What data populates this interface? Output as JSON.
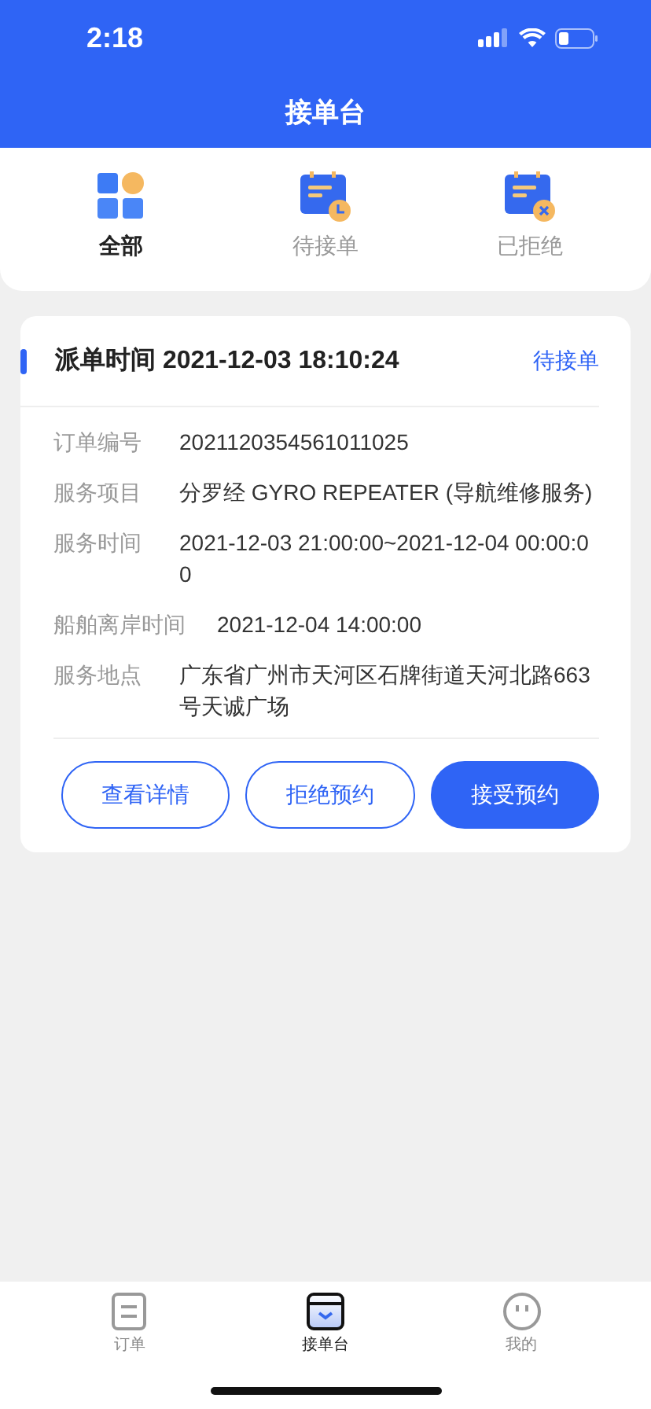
{
  "status_bar": {
    "time": "2:18"
  },
  "header": {
    "title": "接单台"
  },
  "tabs": [
    {
      "label": "全部",
      "kind": "all",
      "selected": true
    },
    {
      "label": "待接单",
      "kind": "pending",
      "selected": false
    },
    {
      "label": "已拒绝",
      "kind": "rejected",
      "selected": false
    }
  ],
  "order": {
    "dispatch_time": "派单时间 2021-12-03 18:10:24",
    "status": "待接单",
    "fields": [
      {
        "label": "订单编号",
        "value": "2021120354561011025"
      },
      {
        "label": "服务项目",
        "value": "分罗经 GYRO REPEATER (导航维修服务)"
      },
      {
        "label": "服务时间",
        "value": "2021-12-03 21:00:00~2021-12-04 00:00:00"
      },
      {
        "label": "船舶离岸时间",
        "value": "2021-12-04 14:00:00"
      },
      {
        "label": "服务地点",
        "value": "广东省广州市天河区石牌街道天河北路663号天诚广场"
      }
    ],
    "buttons": [
      {
        "label": "查看详情",
        "kind": "outline"
      },
      {
        "label": "拒绝预约",
        "kind": "outline"
      },
      {
        "label": "接受预约",
        "kind": "primary"
      }
    ]
  },
  "bottom_nav": [
    {
      "label": "订单",
      "kind": "orders",
      "selected": false
    },
    {
      "label": "接单台",
      "kind": "desk",
      "selected": true
    },
    {
      "label": "我的",
      "kind": "me",
      "selected": false
    }
  ]
}
